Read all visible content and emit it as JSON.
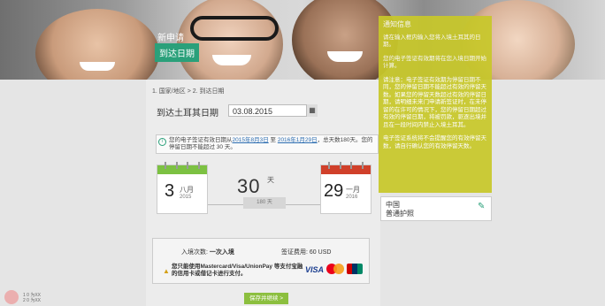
{
  "hero": {
    "title": "新申请",
    "badge": "到达日期"
  },
  "breadcrumb": {
    "step1": "1. 国家/地区",
    "sep": ">",
    "step2": "2. 到达日期"
  },
  "arrival": {
    "label": "到达土耳其日期",
    "value": "03.08.2015",
    "calendar_icon": "calendar-icon"
  },
  "notice": {
    "prefix": "您的电子签证有效日期从",
    "from_date": "2015年8月3日",
    "mid": "至",
    "to_date": "2016年1月29日",
    "suffix": "，总天数180天。您的停留日期不能超过 30 天。"
  },
  "start_cal": {
    "day": "3",
    "month": "八月",
    "year": "2015",
    "color": "#7cc142"
  },
  "end_cal": {
    "day": "29",
    "month": "一月",
    "year": "2016",
    "color": "#d0402a"
  },
  "duration": {
    "value": "30",
    "unit": "天",
    "total": "180 天"
  },
  "fees": {
    "entries_label": "入境次数:",
    "entries_value": "一次入境",
    "fee_label": "签证费用:",
    "fee_value": "60 USD",
    "card_note": "您只能使用Mastercard/Visa/UnionPay 等支付宝融的信用卡或借记卡进行支付。",
    "visa_label": "VISA"
  },
  "submit_label": "保存并继续 >",
  "sidebar": {
    "title": "通知信息",
    "p1": "请在输入框内输入您将入境土耳其的日期。",
    "p2": "您的电子签证有效期将在您入境日期开始计算。",
    "p3": "请注意：电子签证有效期为停留日期不同，您的停留日期不能超过有效的停留天数。如果您的停留天数超过有效的停留日期，请明细未来门申请新签证时，在未停留的在许可的情况下，您的停留日期超过有效的停留日期，将被罚款，驱逐出境并且在一段时间内禁止入境土耳其。",
    "p4": "电子签证系统将不会提醒您的有效停留天数，请自行确认您的有效停留天数。"
  },
  "passport": {
    "line1": "中国",
    "line2": "普通护照"
  },
  "footer": {
    "line1": "1  0 为XX",
    "line2": "2  0 为XX"
  }
}
